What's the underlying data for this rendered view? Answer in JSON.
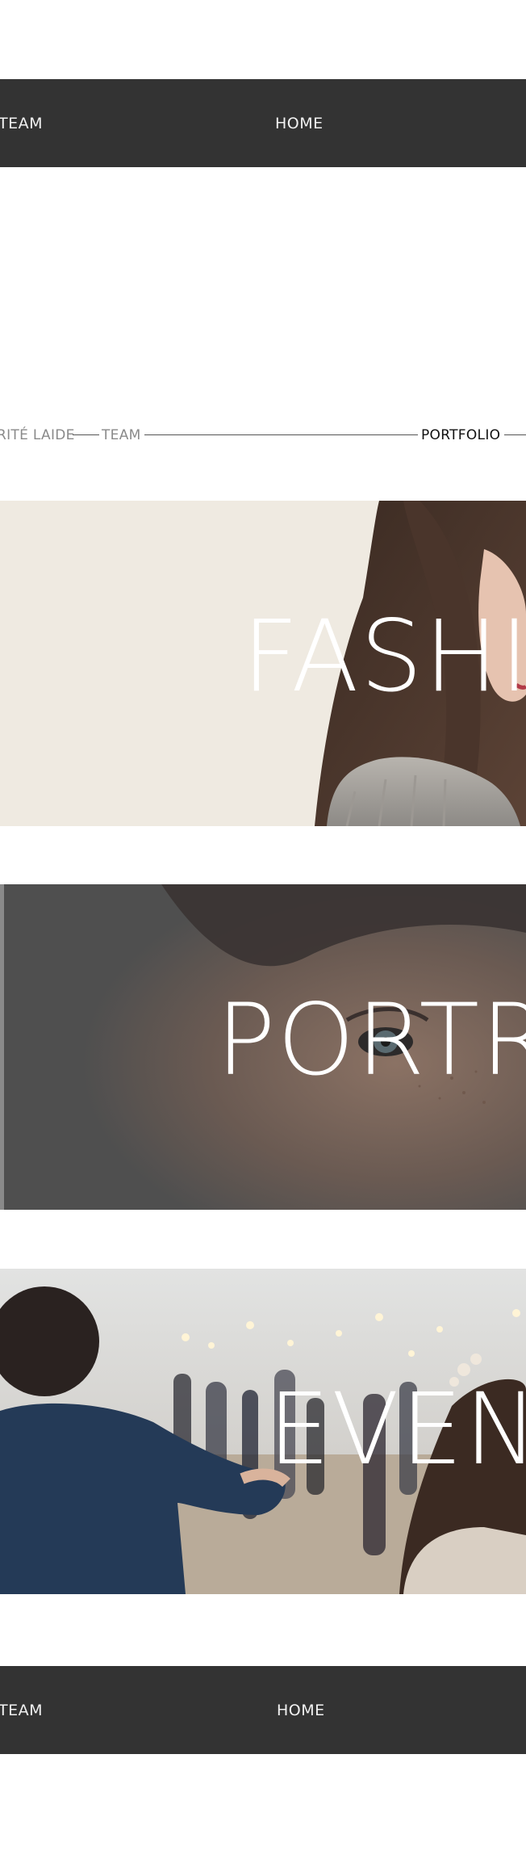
{
  "top_nav": {
    "items": [
      "TEAM",
      "HOME"
    ]
  },
  "breadcrumb": {
    "items": [
      "RITÉ LAIDE",
      "TEAM",
      "PORTFOLIO"
    ],
    "active_index": 2
  },
  "portfolio": {
    "categories": [
      {
        "title": "FASHIO",
        "image": "woman-profile-photo",
        "bg_color": "#efeae1"
      },
      {
        "title": "PORTR",
        "image": "woman-face-closeup-photo",
        "bg_color": "#4f4f4f"
      },
      {
        "title": "EVEN",
        "image": "outdoor-event-crowd-photo",
        "bg_color": "#c9c2b8"
      }
    ]
  },
  "bottom_nav": {
    "items": [
      "TEAM",
      "HOME"
    ]
  },
  "colors": {
    "nav_bg": "#333333",
    "nav_text": "#f2f2f2",
    "page_bg": "#ffffff"
  }
}
